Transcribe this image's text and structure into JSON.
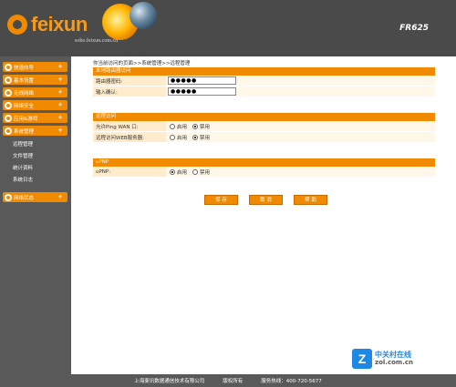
{
  "header": {
    "logo_text": "feixun",
    "site_url": "soho.feixun.com.cn",
    "model": "FR625"
  },
  "sidebar": {
    "items": [
      {
        "label": "快速向导"
      },
      {
        "label": "基本设置"
      },
      {
        "label": "无线网络"
      },
      {
        "label": "网络安全"
      },
      {
        "label": "应用&游戏"
      },
      {
        "label": "系统管理"
      }
    ],
    "submenu": [
      {
        "label": "远程管理"
      },
      {
        "label": "文件管理"
      },
      {
        "label": "统计资料"
      },
      {
        "label": "系统日志"
      }
    ],
    "last_item": {
      "label": "网络状态"
    },
    "expand_symbol": "+"
  },
  "breadcrumb": "你当前访问的页面>>系统管理>>远程管理",
  "local_access": {
    "title": "本地路由器访问",
    "password_label": "路由器密码:",
    "password_value": "●●●●●",
    "confirm_label": "输入确认:",
    "confirm_value": "●●●●●"
  },
  "remote_access": {
    "title": "远程访问",
    "ping_label": "允许Ping WAN 口:",
    "web_label": "远程访问WEB服务器:",
    "enable": "启用",
    "disable": "禁用"
  },
  "upnp": {
    "title": "uPNP",
    "label": "uPNP:",
    "enable": "启用",
    "disable": "禁用"
  },
  "buttons": {
    "save": "保 存",
    "cancel": "取 消",
    "help": "帮 助"
  },
  "watermark": {
    "cn": "中关村在线",
    "en": "zol.com.cn",
    "mark": "Z"
  },
  "footer": {
    "company": "上海斐讯数据通信技术有限公司",
    "rights": "版权所有",
    "hotline": "服务热线：400-720-5677"
  },
  "colors": {
    "accent": "#f08a00",
    "header_bg": "#4a4a4a",
    "sidebar_bg": "#595959",
    "row_bg": "#ffeccc"
  }
}
